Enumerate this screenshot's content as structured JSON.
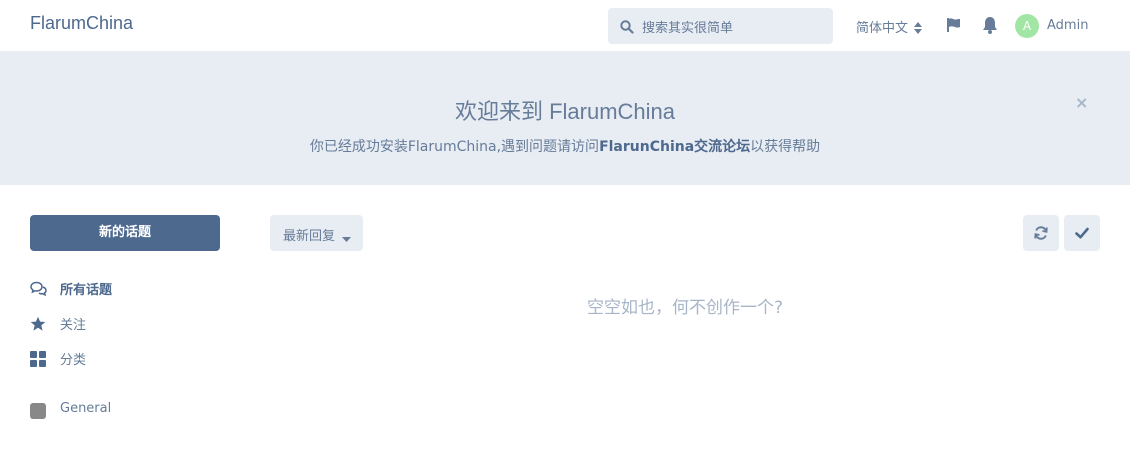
{
  "header": {
    "brand": "FlarumChina",
    "search_placeholder": "搜索其实很简单",
    "language": "简体中文",
    "avatar_letter": "A",
    "username": "Admin"
  },
  "hero": {
    "title": "欢迎来到 FlarumChina",
    "desc_before": "你已经成功安装FlarumChina,遇到问题请访问",
    "desc_link": "FlarunChina交流论坛",
    "desc_after": "以获得帮助",
    "close_glyph": "×"
  },
  "sidebar": {
    "new_discussion": "新的话题",
    "nav": [
      {
        "label": "所有话题",
        "icon": "comments-icon",
        "active": true
      },
      {
        "label": "关注",
        "icon": "star-icon",
        "active": false
      },
      {
        "label": "分类",
        "icon": "grid-icon",
        "active": false
      }
    ],
    "tags": [
      {
        "label": "General",
        "color": "#888888"
      }
    ]
  },
  "toolbar": {
    "sort_label": "最新回复",
    "refresh_icon": "refresh-icon",
    "mark_read_icon": "check-icon"
  },
  "main": {
    "empty_text": "空空如也，何不创作一个?"
  },
  "colors": {
    "primary": "#4d698e",
    "muted": "#667c99",
    "panel": "#e8ecf3",
    "avatar": "#a2e6a5"
  }
}
